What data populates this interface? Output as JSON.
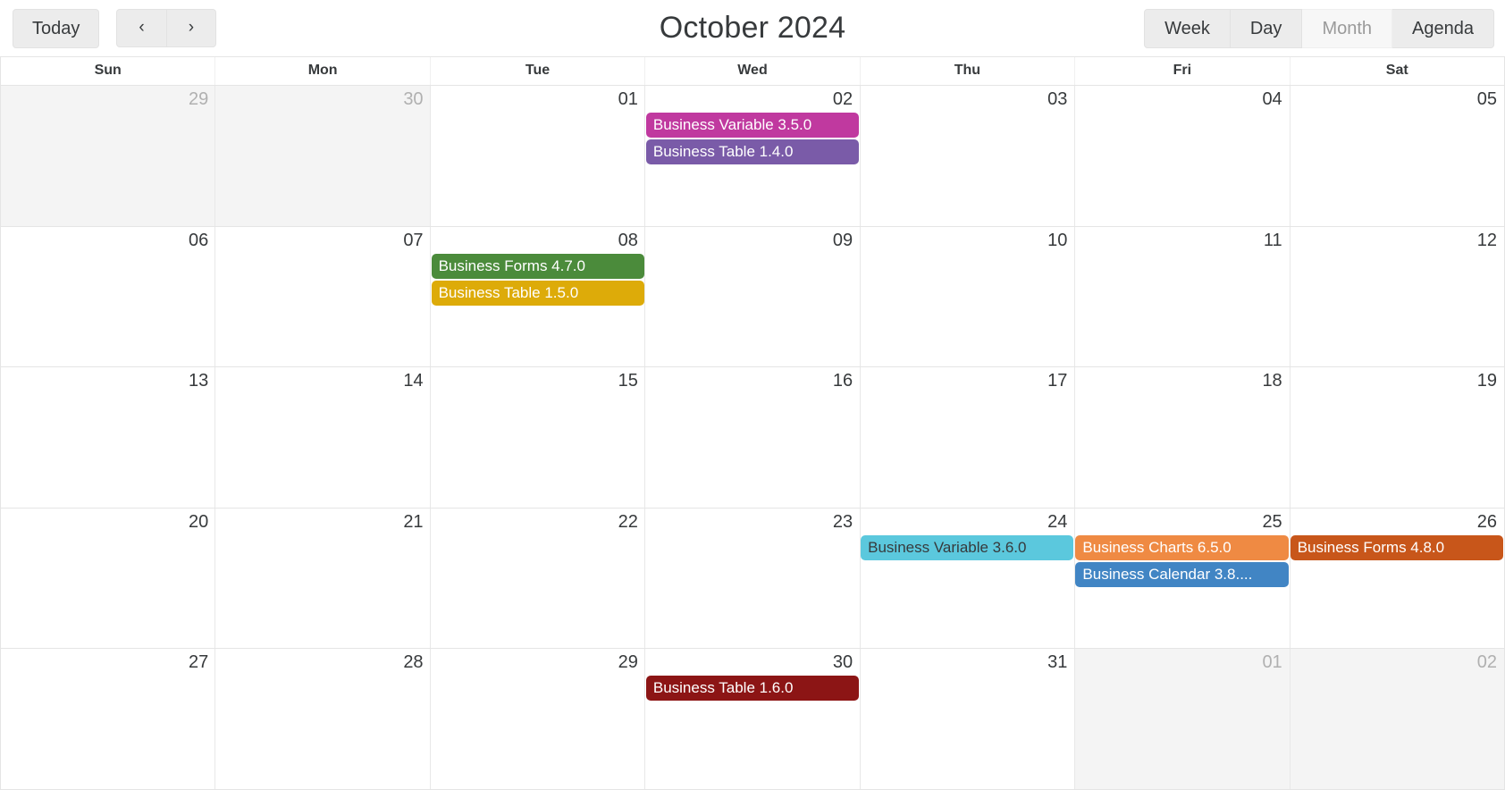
{
  "toolbar": {
    "today_label": "Today",
    "prev_label": "‹",
    "next_label": "›",
    "title": "October 2024",
    "views": [
      {
        "label": "Week",
        "active": false
      },
      {
        "label": "Day",
        "active": false
      },
      {
        "label": "Month",
        "active": true
      },
      {
        "label": "Agenda",
        "active": false
      }
    ]
  },
  "weekdays": [
    "Sun",
    "Mon",
    "Tue",
    "Wed",
    "Thu",
    "Fri",
    "Sat"
  ],
  "colors": {
    "event_magenta": "#c0399f",
    "event_purple": "#7a5ba8",
    "event_green": "#4b8b3b",
    "event_gold": "#ddab09",
    "event_cyan": "#5bc8dd",
    "event_orange": "#ef8a43",
    "event_dark_orange": "#c8561a",
    "event_blue": "#4185c4",
    "event_maroon": "#8c1515",
    "off_day_bg": "#f4f4f4",
    "border": "#e5e5e5",
    "text": "#373a3c"
  },
  "weeks": [
    {
      "days": [
        {
          "num": "29",
          "off": true
        },
        {
          "num": "30",
          "off": true
        },
        {
          "num": "01",
          "off": false
        },
        {
          "num": "02",
          "off": false
        },
        {
          "num": "03",
          "off": false
        },
        {
          "num": "04",
          "off": false
        },
        {
          "num": "05",
          "off": false
        }
      ],
      "event_lines": [
        [
          {
            "col": 3,
            "span": 1,
            "title": "Business Variable 3.5.0",
            "color": "#c0399f",
            "dark_text": false
          }
        ],
        [
          {
            "col": 3,
            "span": 1,
            "title": "Business Table 1.4.0",
            "color": "#7a5ba8",
            "dark_text": false
          }
        ]
      ]
    },
    {
      "days": [
        {
          "num": "06",
          "off": false
        },
        {
          "num": "07",
          "off": false
        },
        {
          "num": "08",
          "off": false
        },
        {
          "num": "09",
          "off": false
        },
        {
          "num": "10",
          "off": false
        },
        {
          "num": "11",
          "off": false
        },
        {
          "num": "12",
          "off": false
        }
      ],
      "event_lines": [
        [
          {
            "col": 2,
            "span": 1,
            "title": "Business Forms 4.7.0",
            "color": "#4b8b3b",
            "dark_text": false
          }
        ],
        [
          {
            "col": 2,
            "span": 1,
            "title": "Business Table 1.5.0",
            "color": "#ddab09",
            "dark_text": false
          }
        ]
      ]
    },
    {
      "days": [
        {
          "num": "13",
          "off": false
        },
        {
          "num": "14",
          "off": false
        },
        {
          "num": "15",
          "off": false
        },
        {
          "num": "16",
          "off": false
        },
        {
          "num": "17",
          "off": false
        },
        {
          "num": "18",
          "off": false
        },
        {
          "num": "19",
          "off": false
        }
      ],
      "event_lines": []
    },
    {
      "days": [
        {
          "num": "20",
          "off": false
        },
        {
          "num": "21",
          "off": false
        },
        {
          "num": "22",
          "off": false
        },
        {
          "num": "23",
          "off": false
        },
        {
          "num": "24",
          "off": false
        },
        {
          "num": "25",
          "off": false
        },
        {
          "num": "26",
          "off": false
        }
      ],
      "event_lines": [
        [
          {
            "col": 4,
            "span": 1,
            "title": "Business Variable 3.6.0",
            "color": "#5bc8dd",
            "dark_text": true
          },
          {
            "col": 5,
            "span": 1,
            "title": "Business Charts 6.5.0",
            "color": "#ef8a43",
            "dark_text": false
          },
          {
            "col": 6,
            "span": 1,
            "title": "Business Forms 4.8.0",
            "color": "#c8561a",
            "dark_text": false
          }
        ],
        [
          {
            "col": 5,
            "span": 1,
            "title": "Business Calendar 3.8....",
            "color": "#4185c4",
            "dark_text": false
          }
        ]
      ]
    },
    {
      "days": [
        {
          "num": "27",
          "off": false
        },
        {
          "num": "28",
          "off": false
        },
        {
          "num": "29",
          "off": false
        },
        {
          "num": "30",
          "off": false
        },
        {
          "num": "31",
          "off": false
        },
        {
          "num": "01",
          "off": true
        },
        {
          "num": "02",
          "off": true
        }
      ],
      "event_lines": [
        [
          {
            "col": 3,
            "span": 1,
            "title": "Business Table 1.6.0",
            "color": "#8c1515",
            "dark_text": false
          }
        ]
      ]
    }
  ]
}
